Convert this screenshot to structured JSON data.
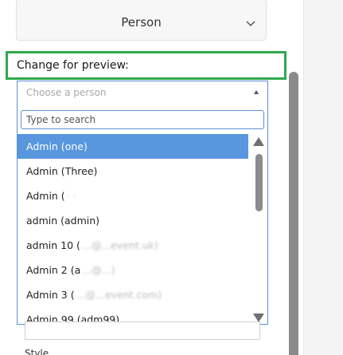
{
  "person_field": {
    "value": "Person"
  },
  "preview": {
    "label": "Change for preview:"
  },
  "chooser": {
    "placeholder": "Choose a person",
    "search_placeholder": "Type to search"
  },
  "people": [
    {
      "name": "Admin (one)",
      "detail": "",
      "selected": true
    },
    {
      "name": "Admin (Three)",
      "detail": "",
      "selected": false
    },
    {
      "name": "Admin (",
      "detail": "·  ·",
      "selected": false
    },
    {
      "name": "admin (admin)",
      "detail": "",
      "selected": false
    },
    {
      "name": "admin 10 (",
      "detail": "...@...event.uk)",
      "selected": false
    },
    {
      "name": "Admin 2 (a",
      "detail": "...@...)",
      "selected": false
    },
    {
      "name": "Admin 3 (",
      "detail": "...@...event.com)",
      "selected": false
    },
    {
      "name": "Admin 99 (adm99)",
      "detail": "",
      "selected": false
    }
  ],
  "below": {
    "style_label": "Style"
  },
  "colors": {
    "highlight": "#5897de",
    "focus_border": "#5b8fd6",
    "annotation_outline": "#2fa84f"
  }
}
